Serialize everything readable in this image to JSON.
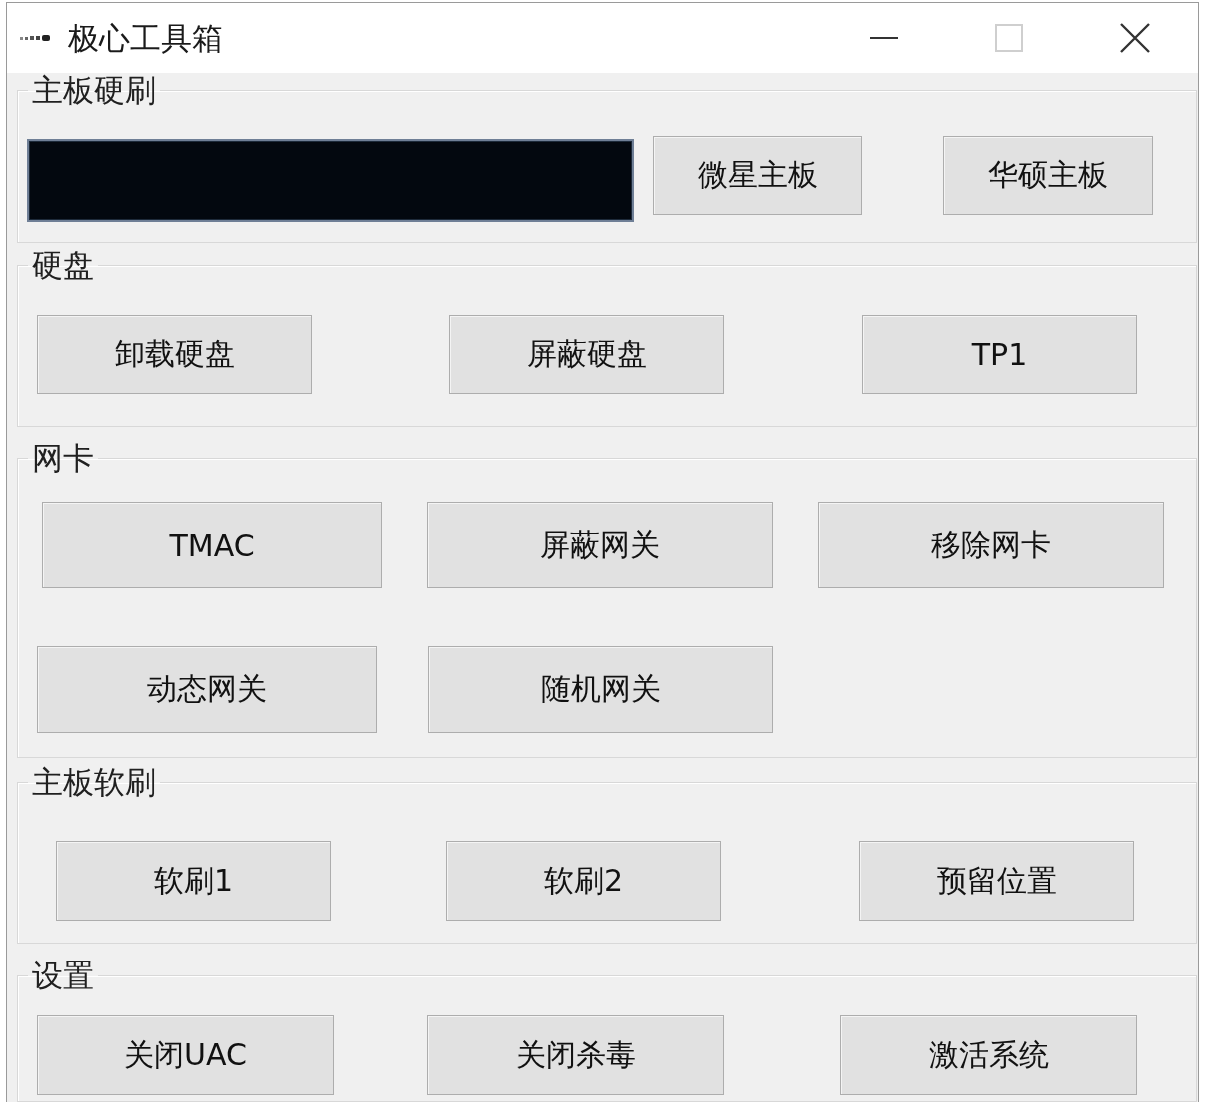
{
  "window": {
    "title": "极心工具箱",
    "controls": [
      {
        "kind": "minimize",
        "disabled": false
      },
      {
        "kind": "maximize",
        "disabled": true
      },
      {
        "kind": "close",
        "disabled": false
      }
    ]
  },
  "groups": [
    {
      "title": "主板硬刷",
      "rows": [
        {
          "items": [
            {
              "kind": "field"
            },
            {
              "kind": "button",
              "label": "微星主板"
            },
            {
              "kind": "button",
              "label": "华硕主板"
            }
          ]
        }
      ]
    },
    {
      "title": "硬盘",
      "rows": [
        {
          "items": [
            {
              "kind": "button",
              "label": "卸载硬盘"
            },
            {
              "kind": "button",
              "label": "屏蔽硬盘"
            },
            {
              "kind": "button",
              "label": "TP1"
            }
          ]
        }
      ]
    },
    {
      "title": "网卡",
      "rows": [
        {
          "items": [
            {
              "kind": "button",
              "label": "TMAC"
            },
            {
              "kind": "button",
              "label": "屏蔽网关"
            },
            {
              "kind": "button",
              "label": "移除网卡"
            }
          ]
        },
        {
          "items": [
            {
              "kind": "button",
              "label": "动态网关"
            },
            {
              "kind": "button",
              "label": "随机网关"
            }
          ]
        }
      ]
    },
    {
      "title": "主板软刷",
      "rows": [
        {
          "items": [
            {
              "kind": "button",
              "label": "软刷1"
            },
            {
              "kind": "button",
              "label": "软刷2"
            },
            {
              "kind": "button",
              "label": "预留位置"
            }
          ]
        }
      ]
    },
    {
      "title": "设置",
      "rows": [
        {
          "items": [
            {
              "kind": "button",
              "label": "关闭UAC"
            },
            {
              "kind": "button",
              "label": "关闭杀毒"
            },
            {
              "kind": "button",
              "label": "激活系统"
            }
          ]
        }
      ]
    }
  ]
}
